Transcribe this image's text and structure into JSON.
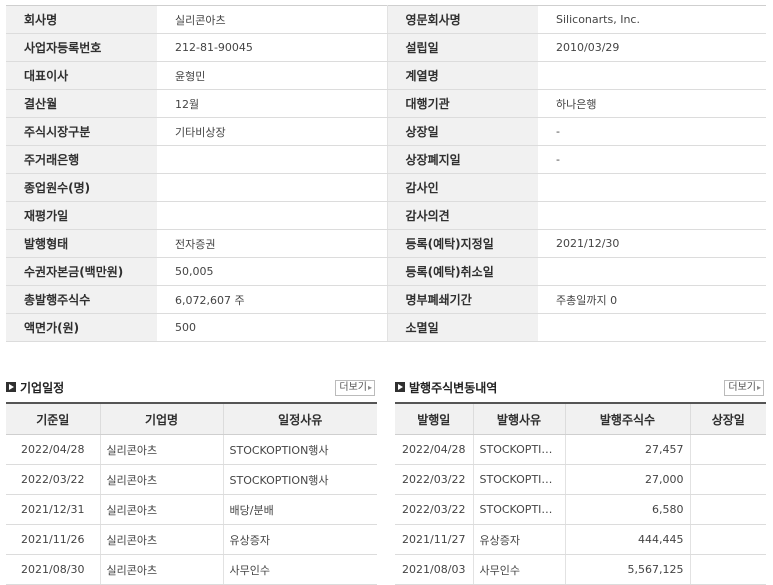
{
  "company_info": {
    "rows": [
      {
        "l1": "회사명",
        "v1": "실리콘아츠",
        "l2": "영문회사명",
        "v2": "Siliconarts, Inc."
      },
      {
        "l1": "사업자등록번호",
        "v1": "212-81-90045",
        "l2": "설립일",
        "v2": "2010/03/29"
      },
      {
        "l1": "대표이사",
        "v1": "윤형민",
        "l2": "계열명",
        "v2": ""
      },
      {
        "l1": "결산월",
        "v1": "12월",
        "l2": "대행기관",
        "v2": "하나은행"
      },
      {
        "l1": "주식시장구분",
        "v1": "기타비상장",
        "l2": "상장일",
        "v2": "-"
      },
      {
        "l1": "주거래은행",
        "v1": "",
        "l2": "상장폐지일",
        "v2": "-"
      },
      {
        "l1": "종업원수(명)",
        "v1": "",
        "l2": "감사인",
        "v2": ""
      },
      {
        "l1": "재평가일",
        "v1": "",
        "l2": "감사의견",
        "v2": ""
      },
      {
        "l1": "발행형태",
        "v1": "전자증권",
        "l2": "등록(예탁)지정일",
        "v2": "2021/12/30"
      },
      {
        "l1": "수권자본금(백만원)",
        "v1": "50,005",
        "l2": "등록(예탁)취소일",
        "v2": ""
      },
      {
        "l1": "총발행주식수",
        "v1": "6,072,607 주",
        "l2": "명부폐쇄기간",
        "v2": "주총일까지 0"
      },
      {
        "l1": "액면가(원)",
        "v1": "500",
        "l2": "소멸일",
        "v2": ""
      }
    ]
  },
  "schedule": {
    "title": "기업일정",
    "more": "더보기",
    "headers": [
      "기준일",
      "기업명",
      "일정사유"
    ],
    "rows": [
      [
        "2022/04/28",
        "실리콘아츠",
        "STOCKOPTION행사"
      ],
      [
        "2022/03/22",
        "실리콘아츠",
        "STOCKOPTION행사"
      ],
      [
        "2021/12/31",
        "실리콘아츠",
        "배당/분배"
      ],
      [
        "2021/11/26",
        "실리콘아츠",
        "유상증자"
      ],
      [
        "2021/08/30",
        "실리콘아츠",
        "사무인수"
      ]
    ]
  },
  "share_changes": {
    "title": "발행주식변동내역",
    "more": "더보기",
    "headers": [
      "발행일",
      "발행사유",
      "발행주식수",
      "상장일"
    ],
    "rows": [
      [
        "2022/04/28",
        "STOCKOPTI…",
        "27,457",
        ""
      ],
      [
        "2022/03/22",
        "STOCKOPTI…",
        "27,000",
        ""
      ],
      [
        "2022/03/22",
        "STOCKOPTI…",
        "6,580",
        ""
      ],
      [
        "2021/11/27",
        "유상증자",
        "444,445",
        ""
      ],
      [
        "2021/08/03",
        "사무인수",
        "5,567,125",
        ""
      ]
    ]
  }
}
